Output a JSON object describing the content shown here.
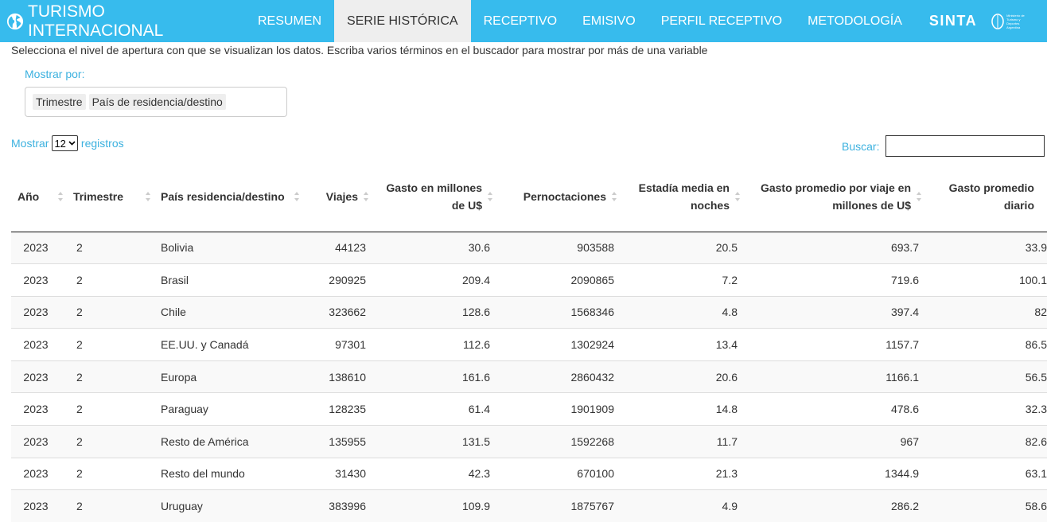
{
  "navbar": {
    "brand": "TURISMO INTERNACIONAL",
    "items": [
      {
        "label": "RESUMEN",
        "active": false
      },
      {
        "label": "SERIE HISTÓRICA",
        "active": true
      },
      {
        "label": "RECEPTIVO",
        "active": false
      },
      {
        "label": "EMISIVO",
        "active": false
      },
      {
        "label": "PERFIL RECEPTIVO",
        "active": false
      },
      {
        "label": "METODOLOGÍA",
        "active": false
      }
    ],
    "sinta": "SINTA",
    "ministry": "Ministerio de Turismo y Deportes Argentina",
    "bg_color": "#37bbed"
  },
  "intro_text": "Selecciona el nivel de apertura con que se visualizan los datos. Escriba varios términos en el buscador para mostrar por más de una variable",
  "filter": {
    "label": "Mostrar por:",
    "chips": [
      "Trimestre",
      "País de residencia/destino"
    ]
  },
  "length": {
    "prefix": "Mostrar",
    "value": "12",
    "suffix": "registros"
  },
  "search": {
    "label": "Buscar:",
    "value": ""
  },
  "table": {
    "headers": [
      "Año",
      "Trimestre",
      "País residencia/destino",
      "Viajes",
      "Gasto en millones de U$",
      "Pernoctaciones",
      "Estadía media en noches",
      "Gasto promedio por viaje en millones de U$",
      "Gasto promedio diario"
    ],
    "rows": [
      [
        "2023",
        "2",
        "Bolivia",
        "44123",
        "30.6",
        "903588",
        "20.5",
        "693.7",
        "33.9"
      ],
      [
        "2023",
        "2",
        "Brasil",
        "290925",
        "209.4",
        "2090865",
        "7.2",
        "719.6",
        "100.1"
      ],
      [
        "2023",
        "2",
        "Chile",
        "323662",
        "128.6",
        "1568346",
        "4.8",
        "397.4",
        "82"
      ],
      [
        "2023",
        "2",
        "EE.UU. y Canadá",
        "97301",
        "112.6",
        "1302924",
        "13.4",
        "1157.7",
        "86.5"
      ],
      [
        "2023",
        "2",
        "Europa",
        "138610",
        "161.6",
        "2860432",
        "20.6",
        "1166.1",
        "56.5"
      ],
      [
        "2023",
        "2",
        "Paraguay",
        "128235",
        "61.4",
        "1901909",
        "14.8",
        "478.6",
        "32.3"
      ],
      [
        "2023",
        "2",
        "Resto de América",
        "135955",
        "131.5",
        "1592268",
        "11.7",
        "967",
        "82.6"
      ],
      [
        "2023",
        "2",
        "Resto del mundo",
        "31430",
        "42.3",
        "670100",
        "21.3",
        "1344.9",
        "63.1"
      ],
      [
        "2023",
        "2",
        "Uruguay",
        "383996",
        "109.9",
        "1875767",
        "4.9",
        "286.2",
        "58.6"
      ]
    ]
  }
}
